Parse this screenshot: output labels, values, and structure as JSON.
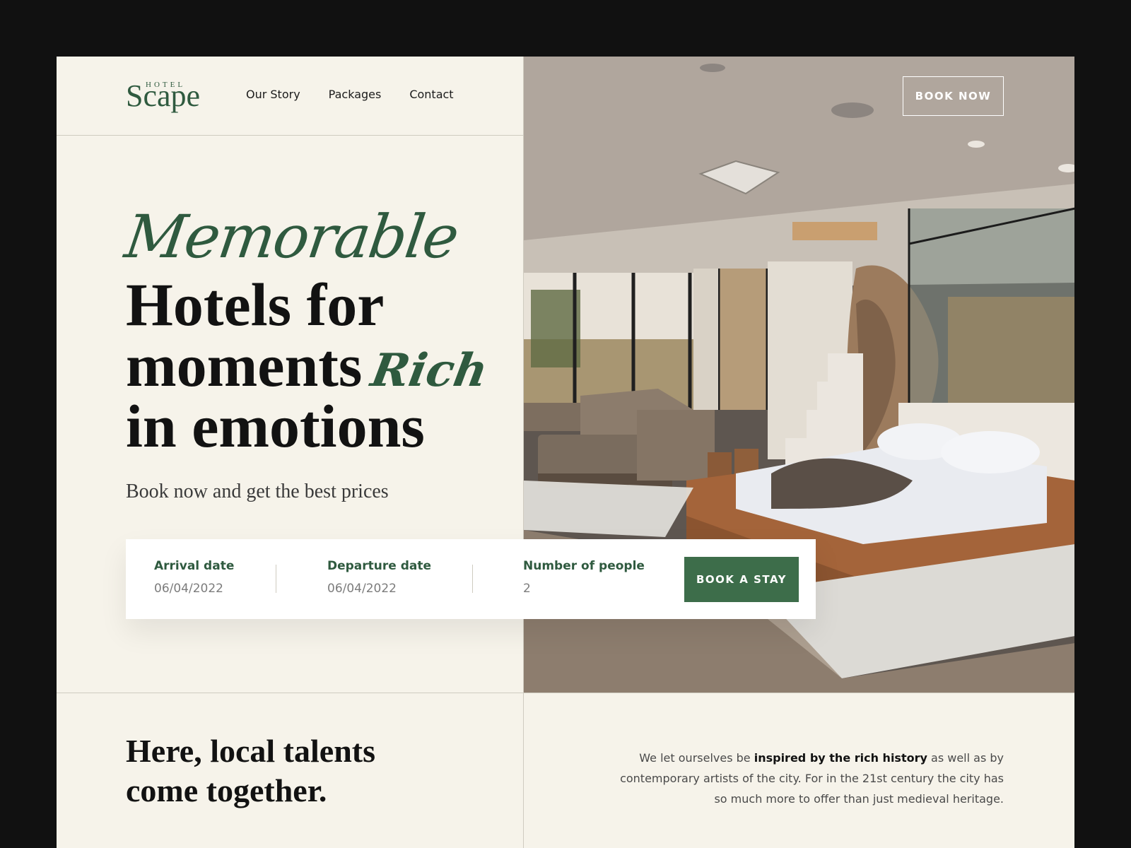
{
  "brand": {
    "logo_small": "HOTEL",
    "logo_big": "Scape"
  },
  "nav": {
    "items": [
      "Our Story",
      "Packages",
      "Contact"
    ]
  },
  "header": {
    "book_now": "BOOK NOW"
  },
  "hero": {
    "script_word": "Memorable",
    "headline_line1": "Hotels for",
    "headline_line2": "moments",
    "script_word2": "Rich",
    "headline_line3": "in emotions",
    "subline": "Book now and get the best prices"
  },
  "booking": {
    "arrival_label": "Arrival date",
    "arrival_value": "06/04/2022",
    "departure_label": "Departure date",
    "departure_value": "06/04/2022",
    "people_label": "Number of people",
    "people_value": "2",
    "cta": "BOOK A STAY"
  },
  "section2": {
    "heading_line1": "Here, local talents",
    "heading_line2": "come together.",
    "body_pre": "We let ourselves be ",
    "body_bold": "inspired by the rich history",
    "body_post": " as well as by contemporary artists of the city. For in the 21st century the city has so much more to offer than just medieval heritage."
  },
  "colors": {
    "accent_green": "#2f5a3f",
    "button_green": "#3d6d4a",
    "background": "#f6f3ea",
    "frame": "#111111"
  }
}
